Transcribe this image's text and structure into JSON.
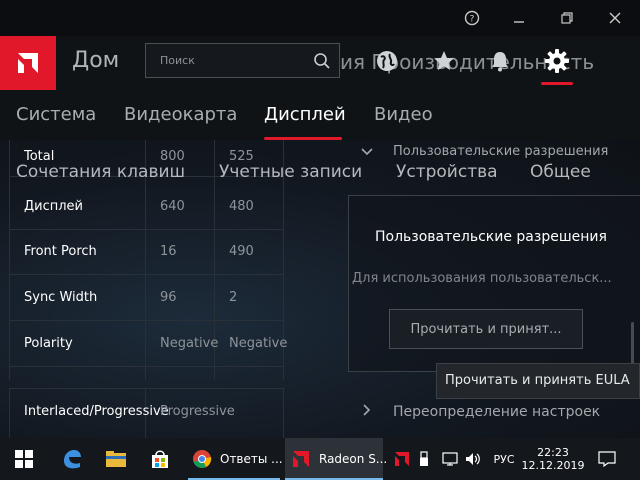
{
  "titlebar": {
    "help_icon": "help-circle-icon",
    "minimize_icon": "minimize-icon",
    "restore_icon": "restore-icon",
    "close_icon": "close-icon"
  },
  "header": {
    "home_label": "Дом",
    "search_placeholder": "Поиск",
    "background_text": "ия Производительность",
    "icons": [
      "globe-icon",
      "star-icon",
      "bell-icon",
      "gear-icon"
    ],
    "accent_color": "#e0182a"
  },
  "tabs": {
    "items": [
      "Система",
      "Видеокарта",
      "Дисплей",
      "Видео"
    ],
    "active": "Дисплей"
  },
  "subtabs_ghost": [
    "Сочетания клавиш",
    "Учетные записи",
    "Устройства",
    "Общее"
  ],
  "timing_table": {
    "rows": [
      {
        "name": "Total",
        "v1": "800",
        "v2": "525"
      },
      {
        "name": "Дисплей",
        "v1": "640",
        "v2": "480"
      },
      {
        "name": "Front Porch",
        "v1": "16",
        "v2": "490"
      },
      {
        "name": "Sync Width",
        "v1": "96",
        "v2": "2"
      },
      {
        "name": "Polarity",
        "v1": "Negative",
        "v2": "Negative"
      }
    ],
    "interlaced": {
      "name": "Interlaced/Progressive",
      "value": "Progressive"
    }
  },
  "custom_resolutions": {
    "section_title": "Пользовательские разрешения",
    "card_title": "Пользовательские разрешения",
    "card_desc": "Для использования пользовательск...",
    "read_button": "Прочитать и принят...",
    "tooltip": "Прочитать и принять EULA"
  },
  "override": {
    "label": "Переопределение настроек"
  },
  "taskbar": {
    "apps": [
      {
        "label": "Ответы ...",
        "icon": "chrome-icon"
      },
      {
        "label": "Radeon S...",
        "icon": "radeon-icon"
      }
    ],
    "language": "РУС",
    "time": "22:23",
    "date": "12.12.2019"
  }
}
